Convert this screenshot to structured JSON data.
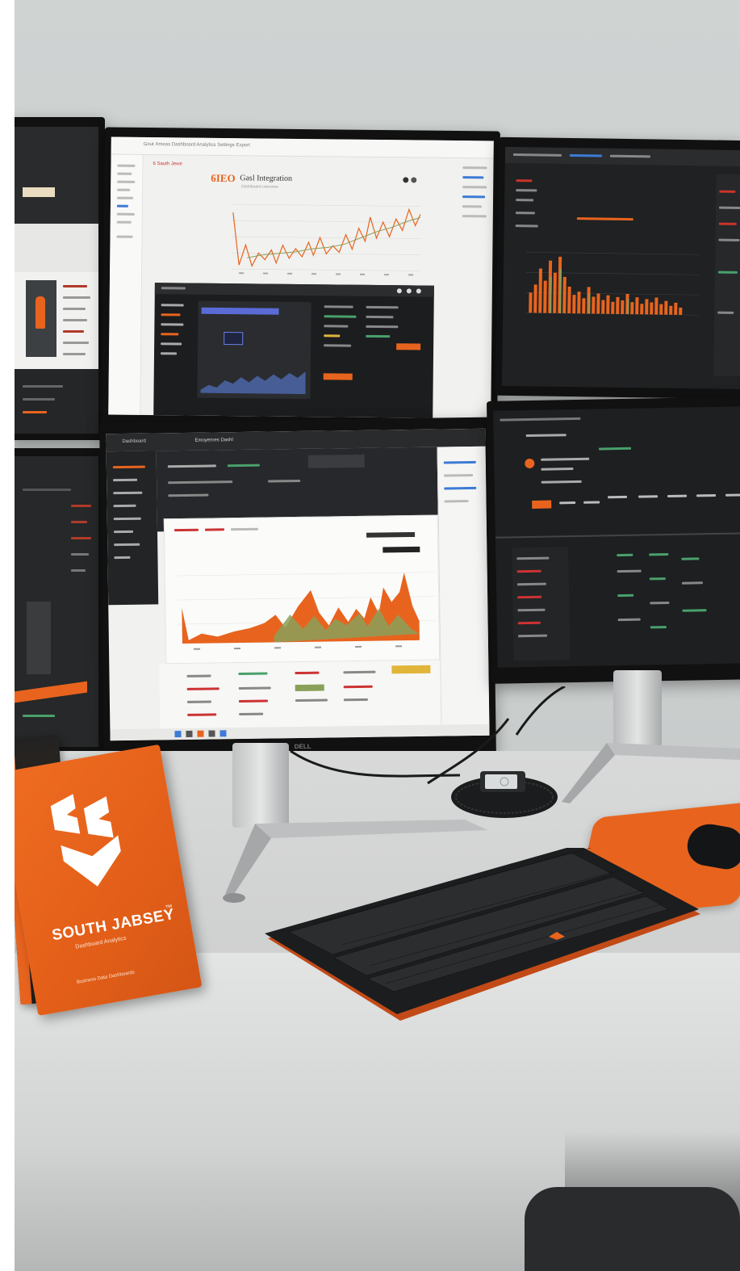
{
  "monitor_top_center": {
    "toolbar_text": "Gout Xmeas  Dashboard  Analytics  Settings  Export",
    "brand_left": "6 Sauth Jewe",
    "logo": "6IEO",
    "title": "Gasl Integration",
    "subtitle": "Dashboard overview"
  },
  "monitor_bottom_center": {
    "tab_label": "Dashboard",
    "title_bar": "Emoyernes  Dashl"
  },
  "monitor_brand": "DELL",
  "book": {
    "title": "SOUTH JABSEY",
    "tm": "™",
    "subtitle": "Dashboard Analytics",
    "footer": "Business Data Dashboards"
  },
  "colors": {
    "accent": "#e8641e",
    "dark_screen": "#1e2022",
    "light_screen": "#f1f1ef",
    "green_series": "#8aa05a"
  },
  "icons": [
    "logo-chevron-icon",
    "keyboard-logo-icon",
    "mouse-icon",
    "phone-icon"
  ]
}
